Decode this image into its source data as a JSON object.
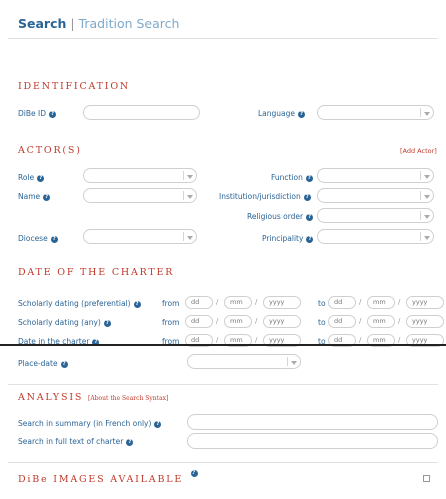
{
  "header": {
    "title_active": "Search",
    "separator": "|",
    "title_alt": "Tradition Search"
  },
  "identification": {
    "heading": "IDENTIFICATION",
    "dibe_id_label": "DiBe ID",
    "language_label": "Language"
  },
  "actors": {
    "heading": "ACTOR(S)",
    "add_actor": "[Add Actor]",
    "role_label": "Role",
    "function_label": "Function",
    "name_label": "Name",
    "institution_label": "Institution/jurisdiction",
    "religious_order_label": "Religious order",
    "diocese_label": "Diocese",
    "principality_label": "Principality"
  },
  "date": {
    "heading": "DATE OF THE CHARTER",
    "from": "from",
    "to": "to",
    "ph_dd": "dd",
    "ph_mm": "mm",
    "ph_yyyy": "yyyy",
    "slash": "/",
    "rows": [
      {
        "label": "Scholarly dating (preferential)"
      },
      {
        "label": "Scholarly dating (any)"
      },
      {
        "label": "Date in the charter"
      }
    ]
  },
  "place": {
    "label": "Place-date"
  },
  "analysis": {
    "heading": "ANALYSIS",
    "syntax_link": "[About the Search Syntax]",
    "summary_label": "Search in summary (in French only)",
    "fulltext_label": "Search in full text of charter"
  },
  "images": {
    "heading": "DiBe IMAGES AVAILABLE"
  },
  "colors": {
    "link": "#2a6496",
    "section": "#c0392b",
    "border": "#cfcfcf"
  }
}
